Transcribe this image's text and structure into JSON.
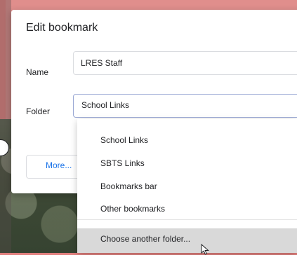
{
  "dialog": {
    "title": "Edit bookmark",
    "name_label": "Name",
    "name_value": "LRES Staff",
    "folder_label": "Folder",
    "folder_value": "School Links",
    "more_button": "More..."
  },
  "dropdown": {
    "items": [
      "School Links",
      "SBTS Links",
      "Bookmarks bar",
      "Other bookmarks"
    ],
    "choose_another": "Choose another folder..."
  },
  "colors": {
    "accent": "#1a73e8",
    "focus_border": "#9aa8d4",
    "hover_bg": "#d9d9d9",
    "background": "#e07f7d"
  },
  "icons": {
    "dropdown_arrow": "chevron-down-icon",
    "cursor": "mouse-pointer-icon"
  }
}
